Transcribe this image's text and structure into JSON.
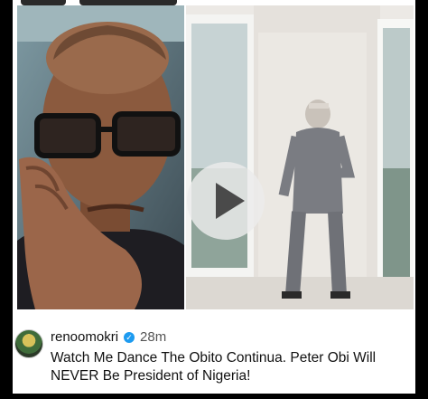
{
  "post": {
    "username": "renoomokri",
    "time_ago": "28m",
    "verified_icon": "verified-badge-icon",
    "caption": "Watch Me Dance The Obito Continua. Peter Obi Will NEVER Be President of Nigeria!"
  },
  "media": {
    "play_icon": "play-icon"
  }
}
